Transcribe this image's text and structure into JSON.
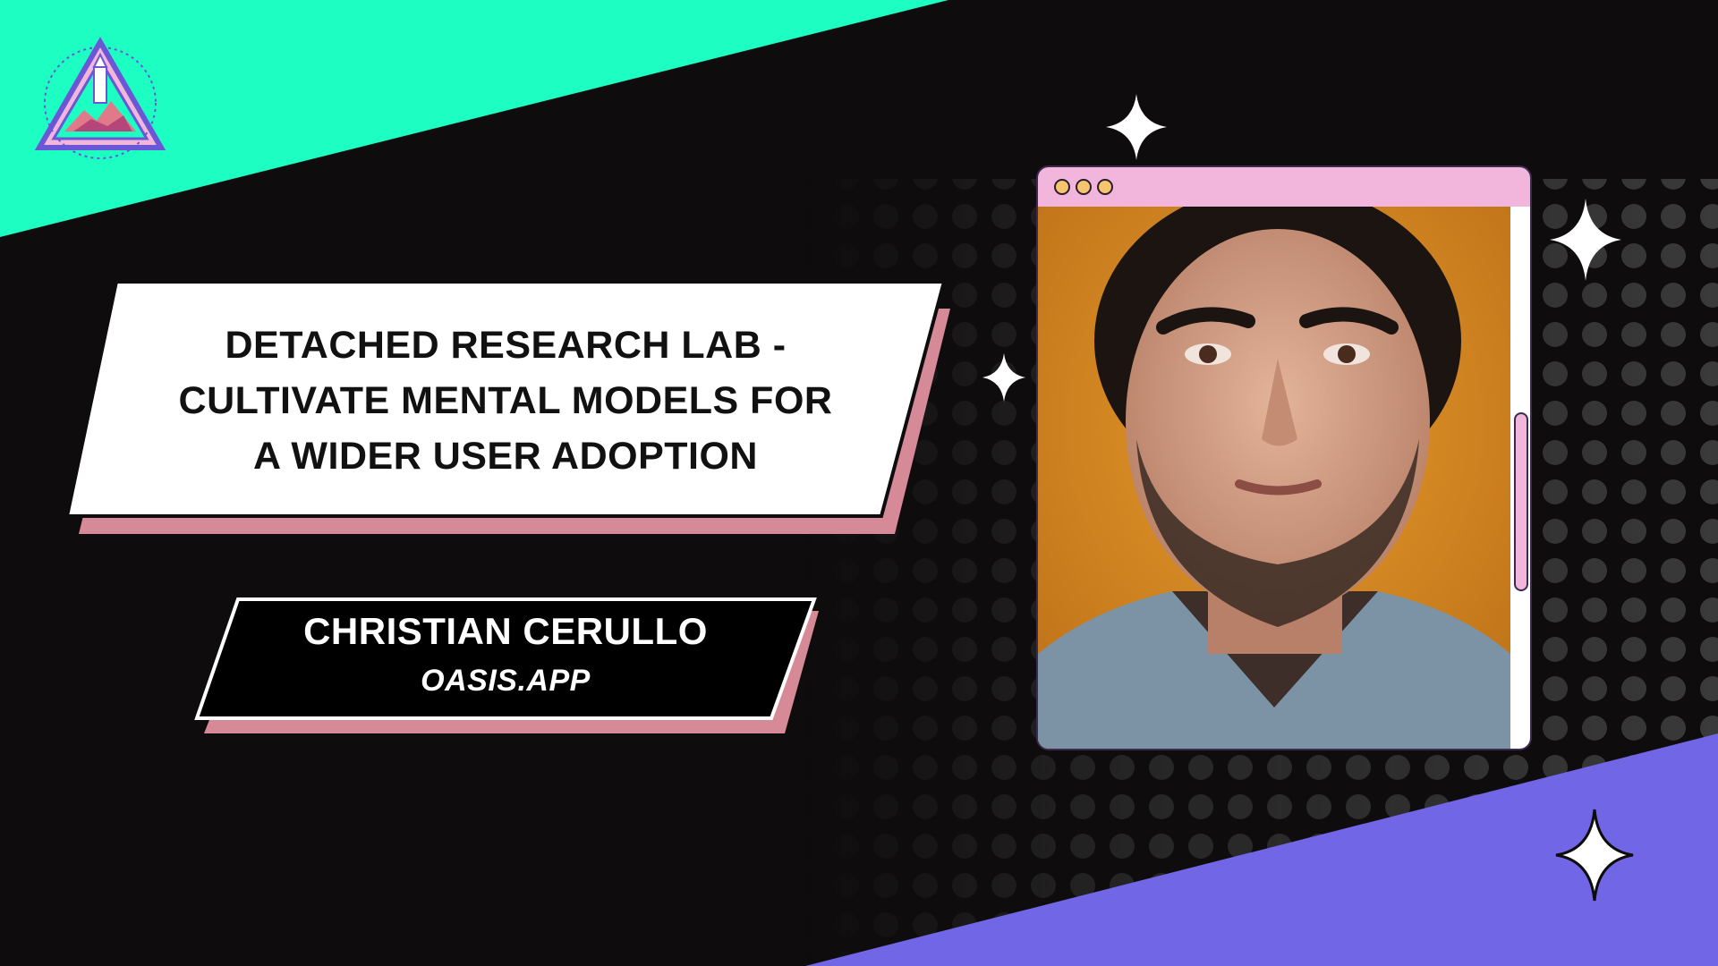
{
  "talk": {
    "title_lines": [
      "DETACHED RESEARCH LAB -",
      "CULTIVATE MENTAL MODELS FOR",
      "A WIDER USER ADOPTION"
    ]
  },
  "speaker": {
    "name": "CHRISTIAN CERULLO",
    "organization": "OASIS.APP"
  },
  "colors": {
    "background": "#0e0c0d",
    "teal": "#1dffc2",
    "purple": "#7166e6",
    "pink_shadow": "#d68a98",
    "browser_bar": "#f2b6dd",
    "photo_background": "#d6871f"
  },
  "icons": {
    "logo": "event-logo-badge",
    "sparkle": "sparkle-star-icon",
    "window_dots": "window-control-dots"
  }
}
